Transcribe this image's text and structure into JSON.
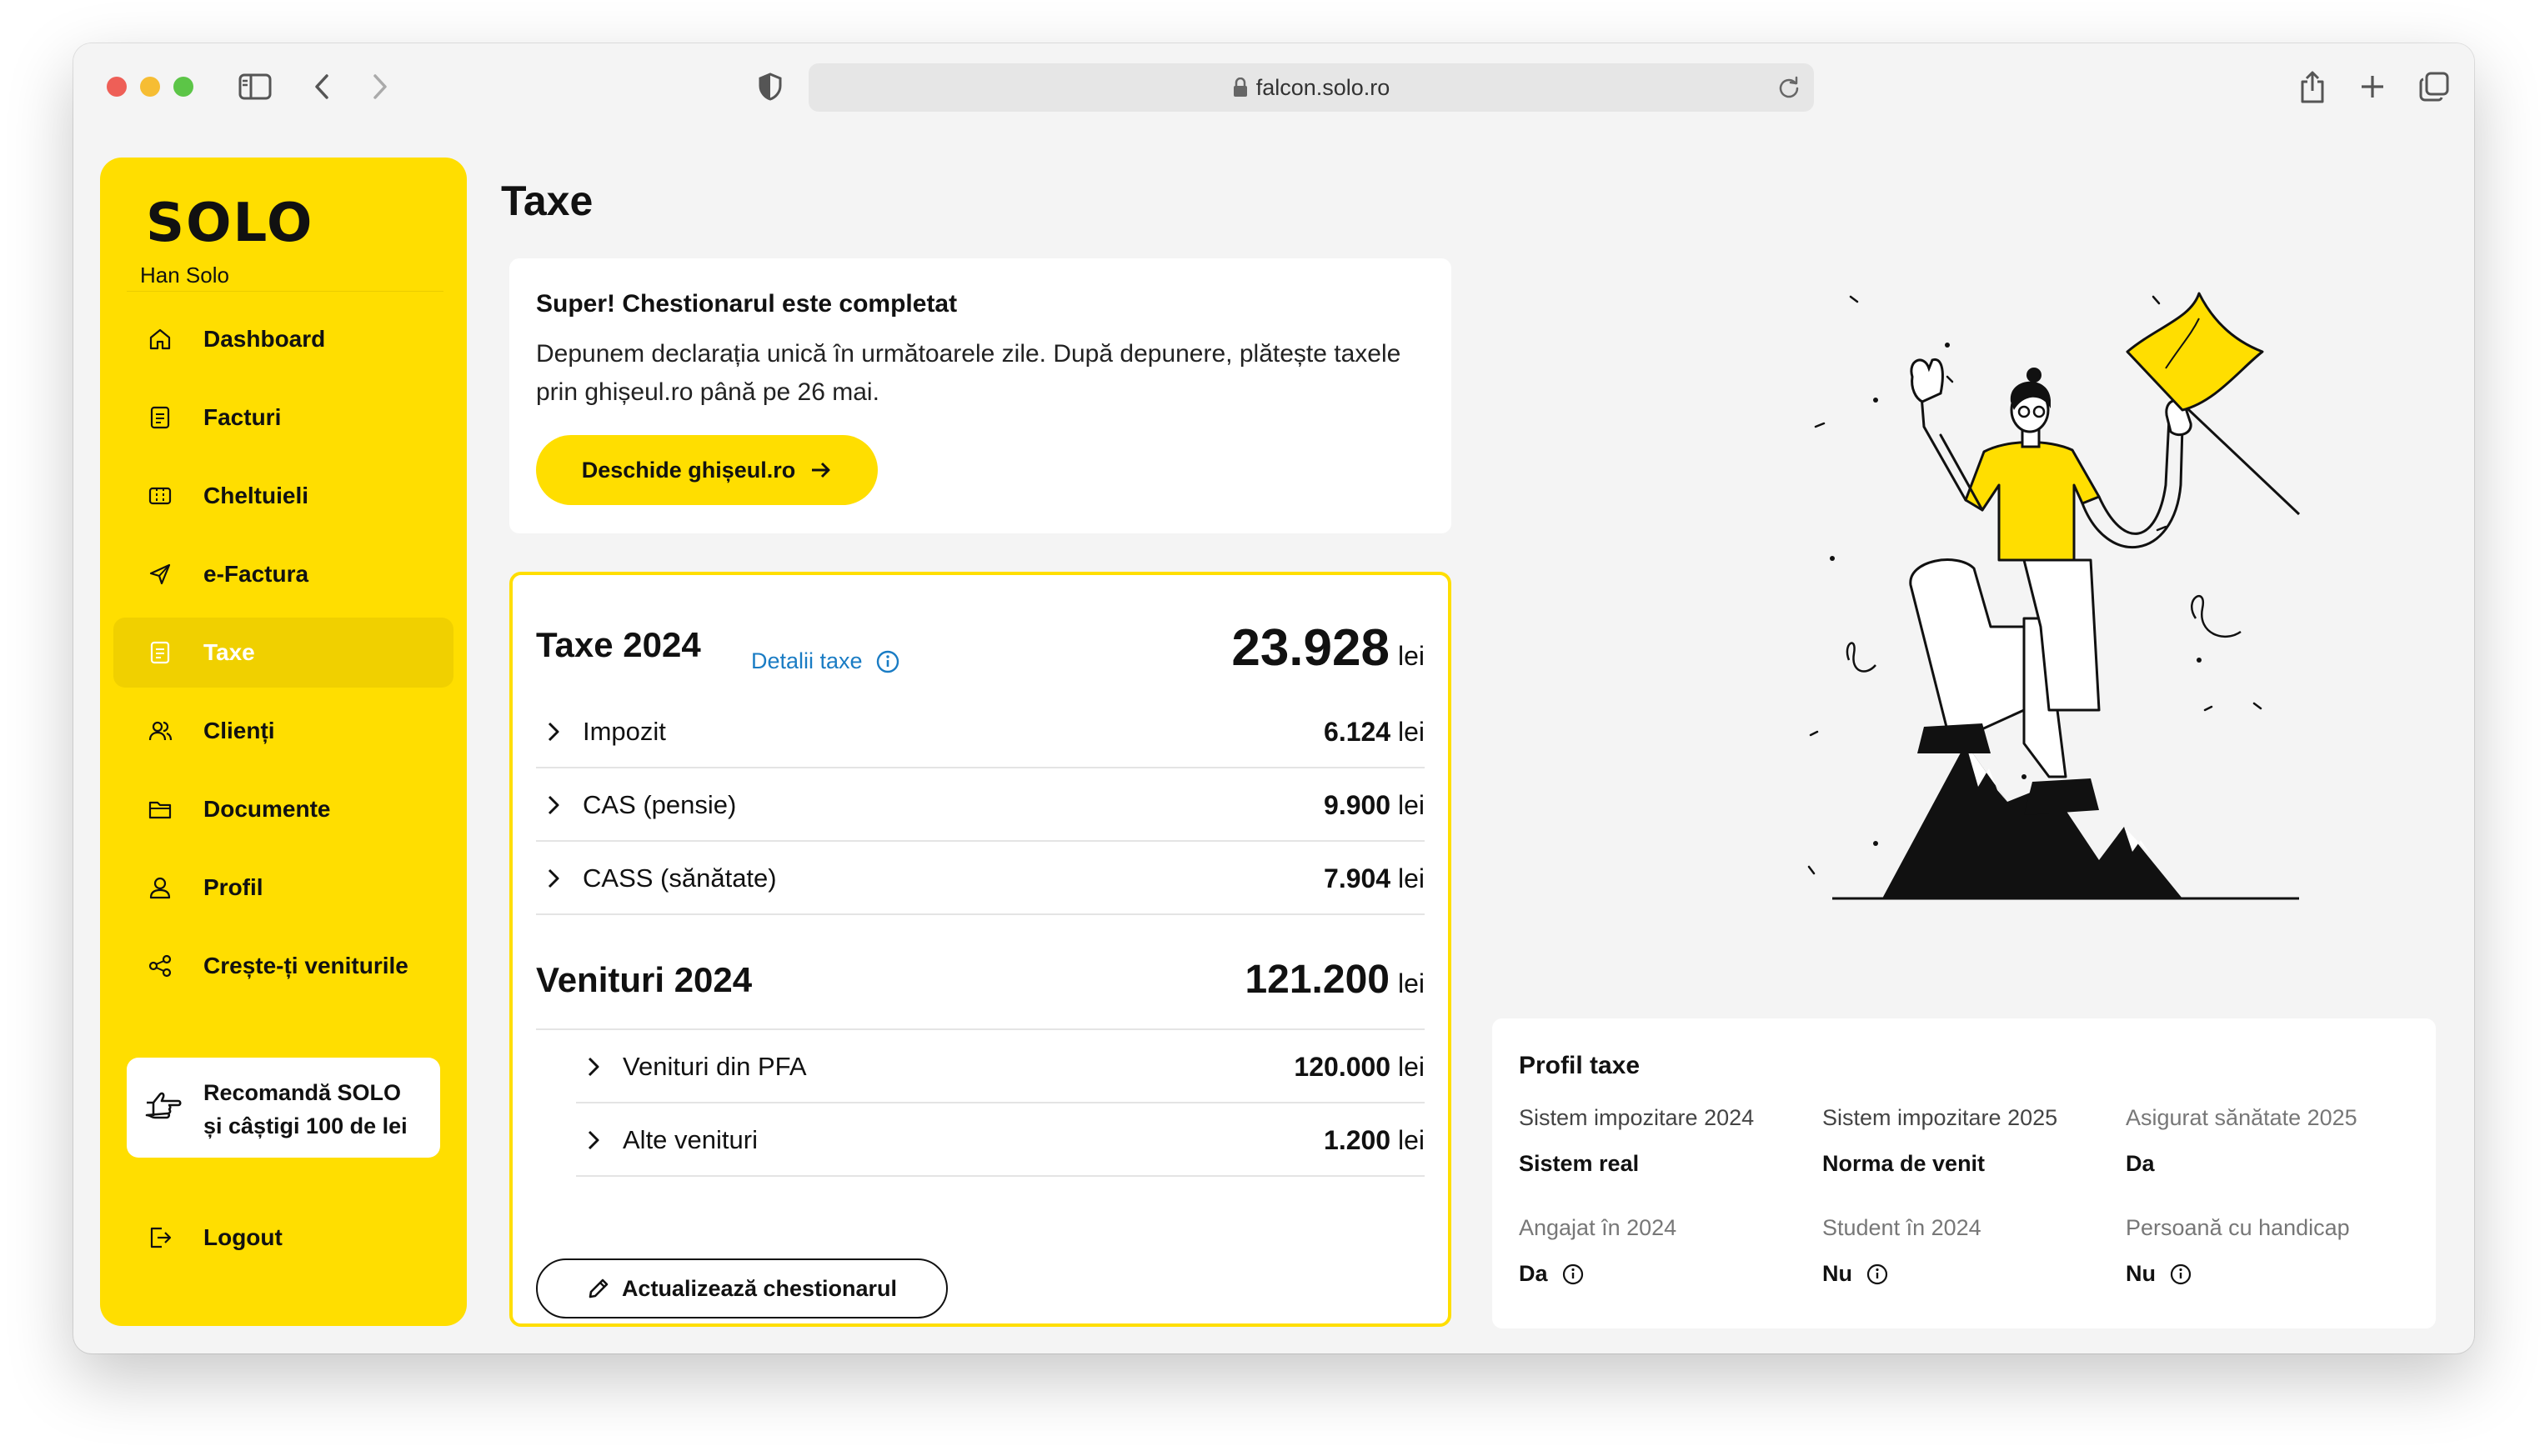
{
  "browser": {
    "url": "falcon.solo.ro"
  },
  "sidebar": {
    "logo_text": "SOLO",
    "user_name": "Han Solo",
    "items": [
      {
        "label": "Dashboard",
        "icon": "home-icon"
      },
      {
        "label": "Facturi",
        "icon": "invoice-icon"
      },
      {
        "label": "Cheltuieli",
        "icon": "receipt-icon"
      },
      {
        "label": "e-Factura",
        "icon": "send-icon"
      },
      {
        "label": "Taxe",
        "icon": "document-icon",
        "active": true
      },
      {
        "label": "Clienți",
        "icon": "users-icon"
      },
      {
        "label": "Documente",
        "icon": "folder-icon"
      },
      {
        "label": "Profil",
        "icon": "user-icon"
      },
      {
        "label": "Crește-ți veniturile",
        "icon": "share-icon"
      }
    ],
    "promo": {
      "line1": "Recomandă SOLO",
      "line2": "și câștigi 100 de lei"
    },
    "logout": "Logout"
  },
  "page": {
    "title": "Taxe"
  },
  "questionnaire": {
    "heading": "Super! Chestionarul este completat",
    "text": "Depunem declarația unică în următoarele zile. După depunere, plătește taxele prin ghișeul.ro până pe 26 mai.",
    "button": "Deschide ghișeul.ro"
  },
  "taxes": {
    "title": "Taxe 2024",
    "details_link": "Detalii taxe",
    "total": "23.928",
    "unit": "lei",
    "rows": [
      {
        "label": "Impozit",
        "value": "6.124"
      },
      {
        "label": "CAS (pensie)",
        "value": "9.900"
      },
      {
        "label": "CASS (sănătate)",
        "value": "7.904"
      }
    ]
  },
  "income": {
    "title": "Venituri 2024",
    "total": "121.200",
    "rows": [
      {
        "label": "Venituri din PFA",
        "value": "120.000"
      },
      {
        "label": "Alte venituri",
        "value": "1.200"
      }
    ],
    "update_button": "Actualizează chestionarul"
  },
  "tax_profile": {
    "heading": "Profil taxe",
    "fields": [
      {
        "label": "Sistem impozitare 2024",
        "value": "Sistem real"
      },
      {
        "label": "Sistem impozitare 2025",
        "value": "Norma de venit"
      },
      {
        "label": "Asigurat sănătate 2025",
        "value": "Da"
      },
      {
        "label": "Angajat în 2024",
        "value": "Da"
      },
      {
        "label": "Student în 2024",
        "value": "Nu"
      },
      {
        "label": "Persoană cu handicap",
        "value": "Nu"
      }
    ]
  },
  "colors": {
    "brand_yellow": "#ffde00",
    "link_blue": "#1a7cc4"
  }
}
